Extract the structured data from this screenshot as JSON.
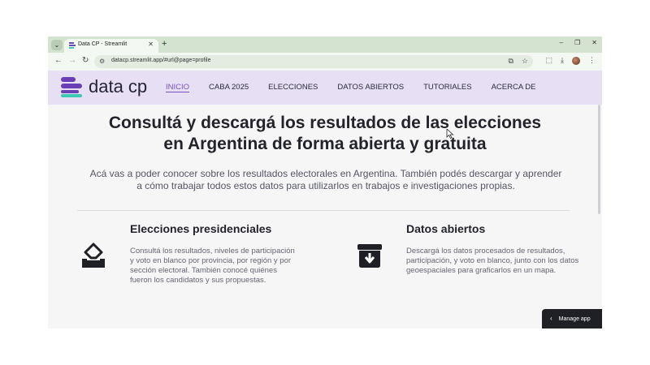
{
  "browser": {
    "tab_title": "Data CP - Streamlit",
    "url": "datacp.streamlit.app/#url@page=profile",
    "new_tab_symbol": "+",
    "window_controls": [
      "–",
      "❐",
      "✕"
    ]
  },
  "navbar": {
    "logo_text": "data cp",
    "items": [
      {
        "label": "INICIO",
        "active": true
      },
      {
        "label": "CABA 2025",
        "active": false
      },
      {
        "label": "ELECCIONES",
        "active": false
      },
      {
        "label": "DATOS ABIERTOS",
        "active": false
      },
      {
        "label": "TUTORIALES",
        "active": false
      },
      {
        "label": "ACERCA DE",
        "active": false
      }
    ]
  },
  "hero": {
    "title_line1": "Consultá y descargá los resultados de las elecciones",
    "title_line2": "en Argentina de forma abierta y gratuita",
    "subtitle_line1": "Acá vas a poder conocer sobre los resultados electorales en Argentina. También podés descargar y aprender",
    "subtitle_line2": "a cómo trabajar todos estos datos para utilizarlos en trabajos e investigaciones propias."
  },
  "features": [
    {
      "icon": "ballot-box-icon",
      "title": "Elecciones presidenciales",
      "text": "Consultá los resultados, niveles de participación y voto en blanco por provincia, por región y por sección electoral. También conocé quiénes fueron los candidatos y sus propuestas."
    },
    {
      "icon": "archive-download-icon",
      "title": "Datos abiertos",
      "text": "Descargá los datos procesados de resultados, participación, y voto en blanco, junto con los datos geoespaciales para graficarlos en un mapa."
    }
  ],
  "manage_app_label": "Manage app",
  "colors": {
    "navbar_bg": "#e7e0f5",
    "accent": "#7b4fc4",
    "logo_teal": "#3cc9b3"
  }
}
